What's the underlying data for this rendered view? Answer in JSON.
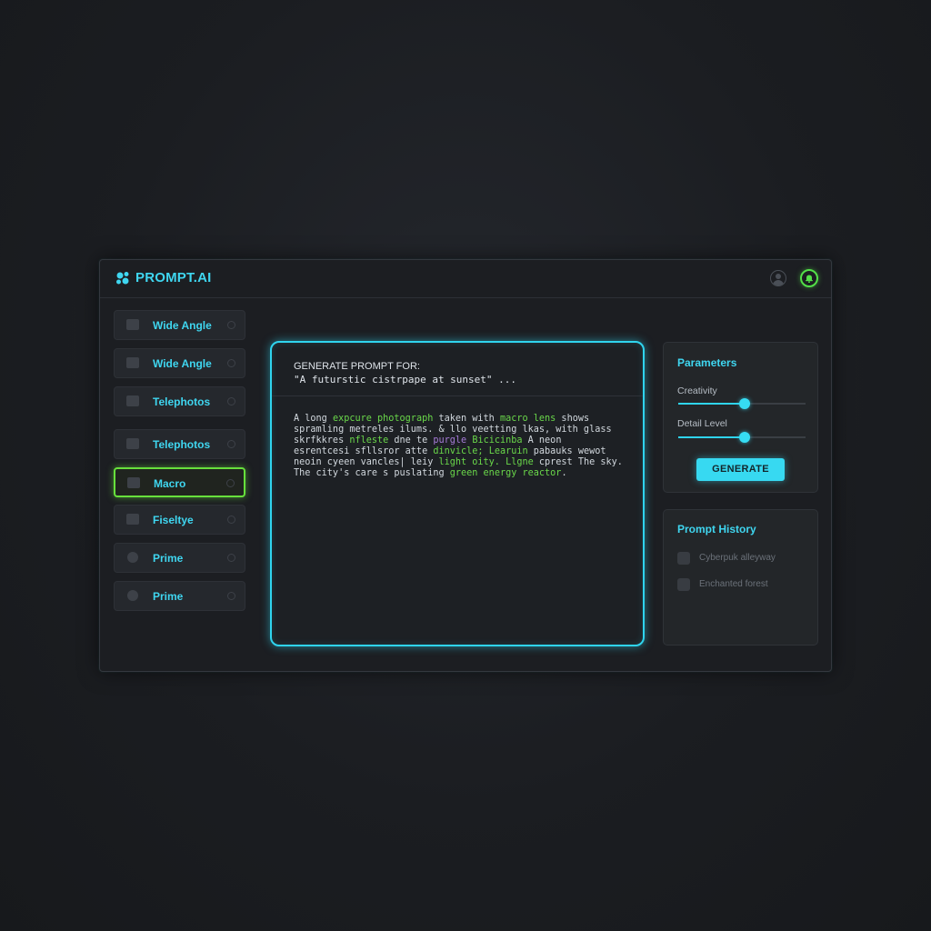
{
  "app": {
    "brand": "PROMPT.AI"
  },
  "header": {
    "user_icon": "user-circle-icon",
    "bell_icon": "bell-icon"
  },
  "sidebar": {
    "items": [
      {
        "label": "Wide Angle",
        "icon": "camera-icon",
        "active": false
      },
      {
        "label": "Wide Angle",
        "icon": "camera-icon",
        "active": false
      },
      {
        "label": "Telephotos",
        "icon": "camera-icon",
        "active": false
      },
      {
        "label": "Telephotos",
        "icon": "camera-icon",
        "active": false
      },
      {
        "label": "Macro",
        "icon": "camera-icon",
        "active": true
      },
      {
        "label": "Fiseltye",
        "icon": "camera-icon",
        "active": false
      },
      {
        "label": "Prime",
        "icon": "lens-icon",
        "active": false
      },
      {
        "label": "Prime",
        "icon": "lens-icon",
        "active": false
      }
    ]
  },
  "editor": {
    "heading": "GENERATE PROMPT FOR:",
    "subject": "\"A futurstic cistrpape at sunset\" ...",
    "lines": [
      [
        {
          "t": "A long "
        },
        {
          "t": "expcure photograph",
          "c": "g"
        },
        {
          "t": " taken with "
        },
        {
          "t": "macro lens",
          "c": "g"
        },
        {
          "t": " shows"
        }
      ],
      [
        {
          "t": "spramling metreles ilums. & llo veetting lkas, with glass"
        }
      ],
      [
        {
          "t": "skrfkkres "
        },
        {
          "t": "nfleste",
          "c": "g"
        },
        {
          "t": " dne te "
        },
        {
          "t": "purgle",
          "c": "p"
        },
        {
          "t": " "
        },
        {
          "t": "Bicicinba",
          "c": "g"
        },
        {
          "t": " A neon"
        }
      ],
      [
        {
          "t": "esrentcesi sfllsror atte "
        },
        {
          "t": "dinvicle;",
          "c": "g"
        },
        {
          "t": " "
        },
        {
          "t": "Learuin",
          "c": "g"
        },
        {
          "t": " pabauks wewot"
        }
      ],
      [
        {
          "t": "neoin cyeen vancles| leiy "
        },
        {
          "t": "light oity.",
          "c": "g"
        },
        {
          "t": " "
        },
        {
          "t": "Llgne",
          "c": "g"
        },
        {
          "t": " cprest The sky."
        }
      ],
      [
        {
          "t": "The city's care s puslating "
        },
        {
          "t": "green energy",
          "c": "g"
        },
        {
          "t": " "
        },
        {
          "t": "reactor",
          "c": "g"
        },
        {
          "t": "."
        }
      ]
    ]
  },
  "parameters": {
    "title": "Parameters",
    "creativity": {
      "label": "Creativity",
      "value": 0.52
    },
    "detail": {
      "label": "Detail Level",
      "value": 0.52
    },
    "button": "GENERATE"
  },
  "history": {
    "title": "Prompt History",
    "items": [
      "Cyberpuk alleyway",
      "Enchanted forest"
    ]
  },
  "colors": {
    "accent_cyan": "#2fd4ee",
    "accent_green": "#67e03c",
    "background": "#1b1d21"
  }
}
